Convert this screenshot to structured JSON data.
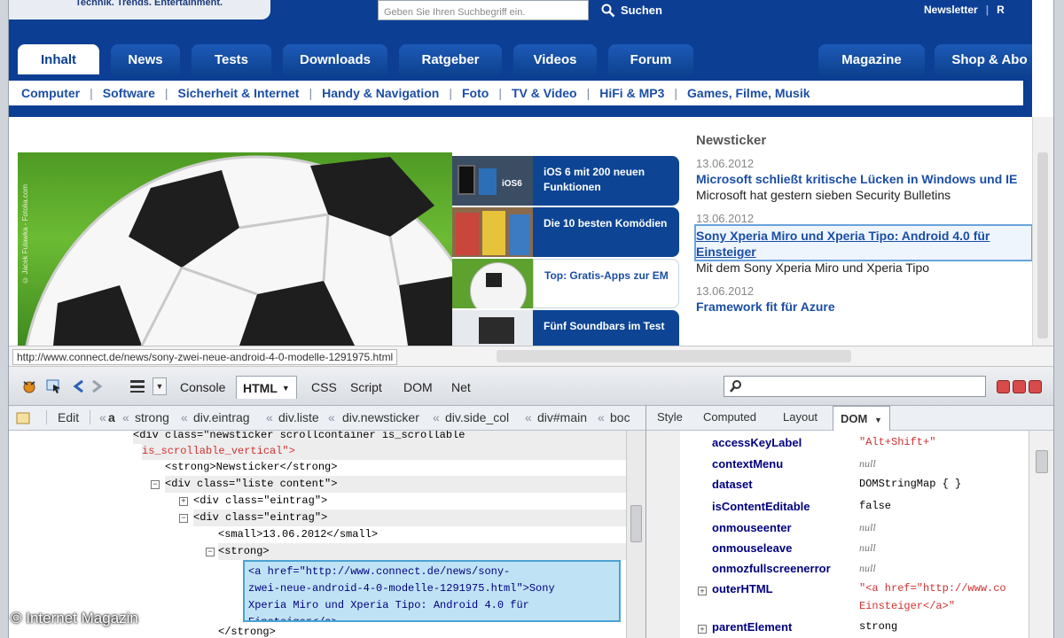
{
  "header": {
    "logo_text": "Technik. Trends. Entertainment.",
    "search_placeholder": "Geben Sie Ihren Suchbegriff ein.",
    "search_button": "Suchen",
    "top_links": [
      "Newsletter",
      "R"
    ]
  },
  "nav": {
    "tabs": [
      "Inhalt",
      "News",
      "Tests",
      "Downloads",
      "Ratgeber",
      "Videos",
      "Forum",
      "Magazine",
      "Shop & Abo"
    ],
    "active": "Inhalt",
    "subnav": [
      "Computer",
      "Software",
      "Sicherheit & Internet",
      "Handy & Navigation",
      "Foto",
      "TV & Video",
      "HiFi & MP3",
      "Games, Filme, Musik"
    ]
  },
  "hero": {
    "caption": "© Jacek Fulawka - Fotolia.com",
    "teasers": [
      {
        "title": "iOS 6 mit 200 neuen Funktionen",
        "thumb_label": "iOS6"
      },
      {
        "title": "Die 10 besten Komödien",
        "thumb_label": ""
      },
      {
        "title": "Top: Gratis-Apps zur EM",
        "thumb_label": ""
      },
      {
        "title": "Fünf Soundbars im Test",
        "thumb_label": ""
      }
    ]
  },
  "newsticker": {
    "title": "Newsticker",
    "items": [
      {
        "date": "13.06.2012",
        "headline": "Microsoft schließt kritische Lücken in Windows und IE",
        "text": "Microsoft hat gestern sieben Security Bulletins"
      },
      {
        "date": "13.06.2012",
        "headline": "Sony Xperia Miro und Xperia Tipo: Android 4.0 für Einsteiger",
        "text": "Mit dem Sony Xperia Miro und Xperia Tipo"
      },
      {
        "date": "13.06.2012",
        "headline": "Framework fit für Azure",
        "text": ""
      }
    ]
  },
  "status_url": "http://www.connect.de/news/sony-zwei-neue-android-4-0-modelle-1291975.html",
  "firebug": {
    "tabs": [
      "Console",
      "HTML",
      "CSS",
      "Script",
      "DOM",
      "Net"
    ],
    "active_tab": "HTML",
    "edit_label": "Edit",
    "breadcrumbs": [
      "a",
      "strong",
      "div.eintrag",
      "div.liste",
      "div.newsticker",
      "div.side_col",
      "div#main",
      "boc"
    ],
    "side_tabs": [
      "Style",
      "Computed",
      "Layout",
      "DOM"
    ],
    "active_side_tab": "DOM",
    "html_lines": [
      {
        "text": "<div class=\"newsticker scrollcontainer is_scrollable"
      },
      {
        "text": "is_scrollable_vertical\">"
      },
      {
        "text": "<strong>Newsticker</strong>"
      },
      {
        "text": "<div class=\"liste content\">"
      },
      {
        "text": "<div class=\"eintrag\">"
      },
      {
        "text": "<div class=\"eintrag\">"
      },
      {
        "text": "<small>13.06.2012</small>"
      },
      {
        "text": "<strong>"
      },
      {
        "text": "</strong>"
      }
    ],
    "selected_node_lines": [
      "<a href=\"http://www.connect.de/news/sony-",
      "zwei-neue-android-4-0-modelle-1291975.html\">Sony",
      "Xperia Miro und Xperia Tipo: Android 4.0 für",
      "Einsteiger</a>"
    ],
    "dom_props": [
      {
        "key": "accessKeyLabel",
        "value": "\"Alt+Shift+\"",
        "kind": "str"
      },
      {
        "key": "contextMenu",
        "value": "null",
        "kind": "null"
      },
      {
        "key": "dataset",
        "value": "DOMStringMap { }",
        "kind": "obj"
      },
      {
        "key": "isContentEditable",
        "value": "false",
        "kind": "obj"
      },
      {
        "key": "onmouseenter",
        "value": "null",
        "kind": "null"
      },
      {
        "key": "onmouseleave",
        "value": "null",
        "kind": "null"
      },
      {
        "key": "onmozfullscreenerror",
        "value": "null",
        "kind": "null"
      },
      {
        "key": "outerHTML",
        "value": "\"<a href=\"http://www.co",
        "kind": "str"
      },
      {
        "key": "",
        "value": "Einsteiger</a>\"",
        "kind": "str"
      },
      {
        "key": "parentElement",
        "value": "strong",
        "kind": "obj"
      }
    ]
  },
  "watermark": "© Internet Magazin",
  "colors": {
    "brand_blue": "#0c3f94",
    "link_blue": "#1b4ea5",
    "selection": "#bfe3f5"
  }
}
